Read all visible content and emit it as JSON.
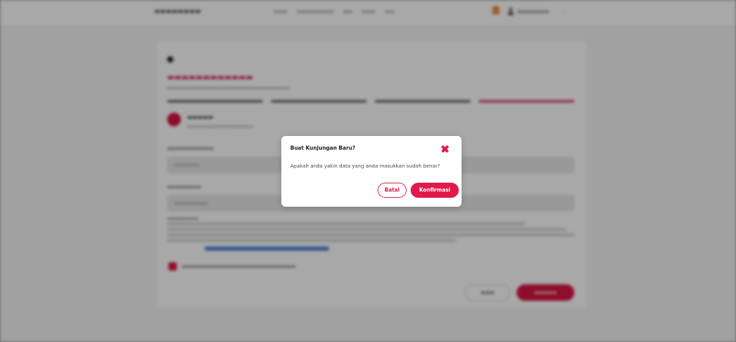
{
  "colors": {
    "accent": "#e01b4b",
    "backdrop": "#9c9c9c"
  },
  "icons": {
    "close": "close-icon",
    "back": "back-arrow-icon",
    "notification": "bell-icon",
    "user": "user-icon"
  },
  "background": {
    "progress_steps": 4,
    "active_step": 4
  },
  "modal": {
    "title": "Buat Kunjungan Baru?",
    "message": "Apakah anda yakin data yang anda masukkan sudah benar?",
    "cancel_label": "Batal",
    "confirm_label": "Konfirmasi"
  }
}
